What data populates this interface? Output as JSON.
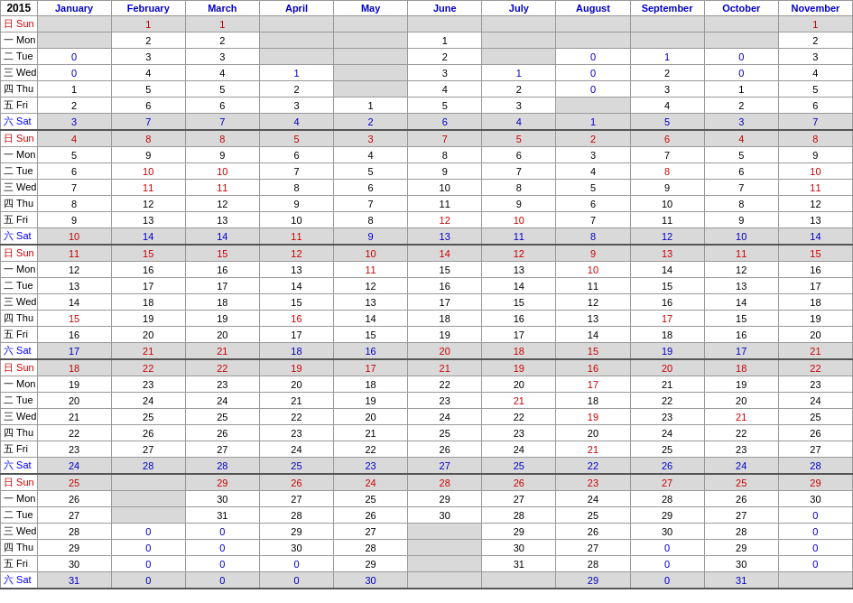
{
  "title": "2015",
  "months": [
    "January",
    "February",
    "March",
    "April",
    "May",
    "June",
    "July",
    "August",
    "September",
    "October",
    "November"
  ],
  "days": [
    {
      "kanji": "日",
      "en": "Sun",
      "type": "sun"
    },
    {
      "kanji": "一",
      "en": "Mon",
      "type": "normal"
    },
    {
      "kanji": "二",
      "en": "Tue",
      "type": "normal"
    },
    {
      "kanji": "三",
      "en": "Wed",
      "type": "normal"
    },
    {
      "kanji": "四",
      "en": "Thu",
      "type": "normal"
    },
    {
      "kanji": "五",
      "en": "Fri",
      "type": "normal"
    },
    {
      "kanji": "六",
      "en": "Sat",
      "type": "sat"
    }
  ],
  "rows": [
    {
      "dow": "sun",
      "label": "日 Sun",
      "jan": "",
      "feb": "1",
      "mar": "1",
      "apr": "",
      "may": "",
      "jun": "",
      "jul": "",
      "aug": "",
      "sep": "",
      "oct": "",
      "nov": "1",
      "jan_c": "black",
      "feb_c": "red",
      "mar_c": "red",
      "apr_c": "gray",
      "may_c": "gray",
      "jun_c": "gray",
      "jul_c": "gray",
      "aug_c": "gray",
      "sep_c": "gray",
      "oct_c": "gray",
      "nov_c": "red"
    },
    {
      "dow": "mon",
      "label": "一 Mon",
      "jan": "",
      "feb": "2",
      "mar": "2",
      "apr": "",
      "may": "",
      "jun": "1",
      "jul": "",
      "aug": "",
      "sep": "",
      "oct": "",
      "nov": "2",
      "jan_c": "black",
      "feb_c": "black",
      "mar_c": "black",
      "apr_c": "gray",
      "may_c": "gray",
      "jun_c": "black",
      "jul_c": "gray",
      "aug_c": "gray",
      "sep_c": "gray",
      "oct_c": "gray",
      "nov_c": "black"
    },
    {
      "dow": "tue",
      "label": "二 Tue",
      "jan": "0",
      "feb": "3",
      "mar": "3",
      "apr": "",
      "may": "",
      "jun": "2",
      "jul": "",
      "aug": "0",
      "sep": "1",
      "oct": "0",
      "nov": "3",
      "jan_c": "blue",
      "feb_c": "black",
      "mar_c": "black",
      "apr_c": "gray",
      "may_c": "gray",
      "jun_c": "black",
      "jul_c": "gray",
      "aug_c": "blue",
      "sep_c": "blue",
      "oct_c": "blue",
      "nov_c": "black"
    },
    {
      "dow": "wed",
      "label": "三 Wed",
      "jan": "0",
      "feb": "4",
      "mar": "4",
      "apr": "1",
      "may": "",
      "jun": "3",
      "jul": "1",
      "aug": "0",
      "sep": "2",
      "oct": "0",
      "nov": "4",
      "jan_c": "blue",
      "feb_c": "black",
      "mar_c": "black",
      "apr_c": "blue",
      "may_c": "gray",
      "jun_c": "black",
      "jul_c": "blue",
      "aug_c": "blue",
      "sep_c": "black",
      "oct_c": "blue",
      "nov_c": "black"
    },
    {
      "dow": "thu",
      "label": "四 Thu",
      "jan": "1",
      "feb": "5",
      "mar": "5",
      "apr": "2",
      "may": "",
      "jun": "4",
      "jul": "2",
      "aug": "0",
      "sep": "3",
      "oct": "1",
      "nov": "5",
      "jan_c": "black",
      "feb_c": "black",
      "mar_c": "black",
      "apr_c": "black",
      "may_c": "gray",
      "jun_c": "black",
      "jul_c": "black",
      "aug_c": "blue",
      "sep_c": "black",
      "oct_c": "black",
      "nov_c": "black"
    },
    {
      "dow": "fri",
      "label": "五 Fri",
      "jan": "2",
      "feb": "6",
      "mar": "6",
      "apr": "3",
      "may": "1",
      "jun": "5",
      "jul": "3",
      "aug": "",
      "sep": "4",
      "oct": "2",
      "nov": "6",
      "jan_c": "black",
      "feb_c": "black",
      "mar_c": "black",
      "apr_c": "black",
      "may_c": "black",
      "jun_c": "black",
      "jul_c": "black",
      "aug_c": "gray",
      "sep_c": "black",
      "oct_c": "black",
      "nov_c": "black"
    },
    {
      "dow": "sat",
      "label": "六 Sat",
      "jan": "3",
      "feb": "7",
      "mar": "7",
      "apr": "4",
      "may": "2",
      "jun": "6",
      "jul": "4",
      "aug": "1",
      "sep": "5",
      "oct": "3",
      "nov": "7",
      "jan_c": "black",
      "feb_c": "black",
      "mar_c": "black",
      "apr_c": "black",
      "may_c": "black",
      "jun_c": "black",
      "jul_c": "black",
      "aug_c": "black",
      "sep_c": "black",
      "oct_c": "black",
      "nov_c": "black"
    },
    {
      "dow": "sun",
      "label": "日 Sun",
      "jan": "4",
      "feb": "8",
      "mar": "8",
      "apr": "5",
      "may": "3",
      "jun": "7",
      "jul": "5",
      "aug": "2",
      "sep": "6",
      "oct": "4",
      "nov": "8"
    },
    {
      "dow": "mon",
      "label": "一 Mon",
      "jan": "5",
      "feb": "9",
      "mar": "9",
      "apr": "6",
      "may": "4",
      "jun": "8",
      "jul": "6",
      "aug": "3",
      "sep": "7",
      "oct": "5",
      "nov": "9"
    },
    {
      "dow": "tue",
      "label": "二 Tue",
      "jan": "6",
      "feb": "10",
      "mar": "10",
      "apr": "7",
      "may": "5",
      "jun": "9",
      "jul": "7",
      "aug": "4",
      "sep": "8",
      "oct": "6",
      "nov": "10",
      "feb_c": "red",
      "mar_c": "red",
      "sep_c": "red",
      "nov_c": "red"
    },
    {
      "dow": "wed",
      "label": "三 Wed",
      "jan": "7",
      "feb": "11",
      "mar": "11",
      "apr": "8",
      "may": "6",
      "jun": "10",
      "jul": "8",
      "aug": "5",
      "sep": "9",
      "oct": "7",
      "nov": "11",
      "feb_c": "red",
      "mar_c": "red",
      "nov_c": "red"
    },
    {
      "dow": "thu",
      "label": "四 Thu",
      "jan": "8",
      "feb": "12",
      "mar": "12",
      "apr": "9",
      "may": "7",
      "jun": "11",
      "jul": "9",
      "aug": "6",
      "sep": "10",
      "oct": "8",
      "nov": "12"
    },
    {
      "dow": "fri",
      "label": "五 Fri",
      "jan": "9",
      "feb": "13",
      "mar": "13",
      "apr": "10",
      "may": "8",
      "jun": "12",
      "jul": "10",
      "aug": "7",
      "sep": "11",
      "oct": "9",
      "nov": "13",
      "jun_c": "red",
      "jul_c": "red"
    },
    {
      "dow": "sat",
      "label": "六 Sat",
      "jan": "10",
      "feb": "14",
      "mar": "14",
      "apr": "11",
      "may": "9",
      "jun": "13",
      "jul": "11",
      "aug": "8",
      "sep": "12",
      "oct": "10",
      "nov": "14",
      "jan_c": "red",
      "apr_c": "red"
    },
    {
      "dow": "sun",
      "label": "日 Sun",
      "jan": "11",
      "feb": "15",
      "mar": "15",
      "apr": "12",
      "may": "10",
      "jun": "14",
      "jul": "12",
      "aug": "9",
      "sep": "13",
      "oct": "11",
      "nov": "15",
      "sep_c": "red",
      "oct_c": "red",
      "nov_c": "red"
    },
    {
      "dow": "mon",
      "label": "一 Mon",
      "jan": "12",
      "feb": "16",
      "mar": "16",
      "apr": "13",
      "may": "11",
      "jun": "15",
      "jul": "13",
      "aug": "10",
      "sep": "14",
      "oct": "12",
      "nov": "16",
      "may_c": "red",
      "aug_c": "red"
    },
    {
      "dow": "tue",
      "label": "二 Tue",
      "jan": "13",
      "feb": "17",
      "mar": "17",
      "apr": "14",
      "may": "12",
      "jun": "16",
      "jul": "14",
      "aug": "11",
      "sep": "15",
      "oct": "13",
      "nov": "17"
    },
    {
      "dow": "wed",
      "label": "三 Wed",
      "jan": "14",
      "feb": "18",
      "mar": "18",
      "apr": "15",
      "may": "13",
      "jun": "17",
      "jul": "15",
      "aug": "12",
      "sep": "16",
      "oct": "14",
      "nov": "18"
    },
    {
      "dow": "thu",
      "label": "四 Thu",
      "jan": "15",
      "feb": "19",
      "mar": "19",
      "apr": "16",
      "may": "14",
      "jun": "18",
      "jul": "16",
      "aug": "13",
      "sep": "17",
      "oct": "15",
      "nov": "19",
      "jan_c": "red",
      "apr_c": "red",
      "sep_c": "red"
    },
    {
      "dow": "fri",
      "label": "五 Fri",
      "jan": "16",
      "feb": "20",
      "mar": "20",
      "apr": "17",
      "may": "15",
      "jun": "19",
      "jul": "17",
      "aug": "14",
      "sep": "18",
      "oct": "16",
      "nov": "20"
    },
    {
      "dow": "sat",
      "label": "六 Sat",
      "jan": "17",
      "feb": "21",
      "mar": "21",
      "apr": "18",
      "may": "16",
      "jun": "20",
      "jul": "18",
      "aug": "15",
      "sep": "19",
      "oct": "17",
      "nov": "21",
      "feb_c": "red",
      "mar_c": "red",
      "jun_c": "red",
      "jul_c": "red",
      "aug_c": "red",
      "nov_c": "red"
    },
    {
      "dow": "sun",
      "label": "日 Sun",
      "jan": "18",
      "feb": "22",
      "mar": "22",
      "apr": "19",
      "may": "17",
      "jun": "21",
      "jul": "19",
      "aug": "16",
      "sep": "20",
      "oct": "18",
      "nov": "22",
      "jun_c": "red",
      "jul_c": "red"
    },
    {
      "dow": "mon",
      "label": "一 Mon",
      "jan": "19",
      "feb": "23",
      "mar": "23",
      "apr": "20",
      "may": "18",
      "jun": "22",
      "jul": "20",
      "aug": "17",
      "sep": "21",
      "oct": "19",
      "nov": "23",
      "aug_c": "red"
    },
    {
      "dow": "tue",
      "label": "二 Tue",
      "jan": "20",
      "feb": "24",
      "mar": "24",
      "apr": "21",
      "may": "19",
      "jun": "23",
      "jul": "21",
      "aug": "18",
      "sep": "22",
      "oct": "20",
      "nov": "24",
      "jul_c": "red"
    },
    {
      "dow": "wed",
      "label": "三 Wed",
      "jan": "21",
      "feb": "25",
      "mar": "25",
      "apr": "22",
      "may": "20",
      "jun": "24",
      "jul": "22",
      "aug": "19",
      "sep": "23",
      "oct": "21",
      "nov": "25",
      "aug_c": "red",
      "oct_c": "red"
    },
    {
      "dow": "thu",
      "label": "四 Thu",
      "jan": "22",
      "feb": "26",
      "mar": "26",
      "apr": "23",
      "may": "21",
      "jun": "25",
      "jul": "23",
      "aug": "20",
      "sep": "24",
      "oct": "22",
      "nov": "26"
    },
    {
      "dow": "fri",
      "label": "五 Fri",
      "jan": "23",
      "feb": "27",
      "mar": "27",
      "apr": "24",
      "may": "22",
      "jun": "26",
      "jul": "24",
      "aug": "21",
      "sep": "25",
      "oct": "23",
      "nov": "27",
      "aug_c": "red"
    },
    {
      "dow": "sat",
      "label": "六 Sat",
      "jan": "24",
      "feb": "28",
      "mar": "28",
      "apr": "25",
      "may": "23",
      "jun": "27",
      "jul": "25",
      "aug": "22",
      "sep": "26",
      "oct": "24",
      "nov": "28"
    },
    {
      "dow": "sun",
      "label": "日 Sun",
      "jan": "25",
      "feb": "",
      "mar": "29",
      "apr": "26",
      "may": "24",
      "jun": "28",
      "jul": "26",
      "aug": "23",
      "sep": "27",
      "oct": "25",
      "nov": "29",
      "feb_c": "gray"
    },
    {
      "dow": "mon",
      "label": "一 Mon",
      "jan": "26",
      "feb": "",
      "mar": "30",
      "apr": "27",
      "may": "25",
      "jun": "29",
      "jul": "27",
      "aug": "24",
      "sep": "28",
      "oct": "26",
      "nov": "30",
      "feb_c": "gray"
    },
    {
      "dow": "tue",
      "label": "二 Tue",
      "jan": "27",
      "feb": "",
      "mar": "31",
      "apr": "28",
      "may": "26",
      "jun": "30",
      "jul": "28",
      "aug": "25",
      "sep": "29",
      "oct": "27",
      "nov": "0",
      "feb_c": "gray",
      "nov_c": "blue"
    },
    {
      "dow": "wed",
      "label": "三 Wed",
      "jan": "28",
      "feb": "0",
      "mar": "0",
      "apr": "29",
      "may": "27",
      "jun": "",
      "jul": "29",
      "aug": "26",
      "sep": "30",
      "oct": "28",
      "nov": "0",
      "feb_c": "blue",
      "mar_c": "blue",
      "jun_c": "gray",
      "nov_c": "blue"
    },
    {
      "dow": "thu",
      "label": "四 Thu",
      "jan": "29",
      "feb": "0",
      "mar": "0",
      "apr": "30",
      "may": "28",
      "jun": "",
      "jul": "30",
      "aug": "27",
      "sep": "0",
      "oct": "29",
      "nov": "0",
      "feb_c": "blue",
      "mar_c": "blue",
      "jun_c": "gray",
      "sep_c": "blue",
      "nov_c": "blue"
    },
    {
      "dow": "fri",
      "label": "五 Fri",
      "jan": "30",
      "feb": "0",
      "mar": "0",
      "apr": "0",
      "may": "29",
      "jun": "",
      "jul": "31",
      "aug": "28",
      "sep": "0",
      "oct": "30",
      "nov": "0",
      "feb_c": "blue",
      "mar_c": "blue",
      "apr_c": "blue",
      "jun_c": "gray",
      "sep_c": "blue",
      "nov_c": "blue"
    },
    {
      "dow": "sat",
      "label": "六 Sat",
      "jan": "31",
      "feb": "0",
      "mar": "0",
      "apr": "0",
      "may": "30",
      "jun": "",
      "jul": "",
      "aug": "29",
      "sep": "0",
      "oct": "31",
      "nov": "",
      "feb_c": "blue",
      "mar_c": "blue",
      "apr_c": "blue",
      "jun_c": "gray",
      "jul_c": "gray",
      "sep_c": "blue",
      "nov_c": "gray"
    }
  ]
}
